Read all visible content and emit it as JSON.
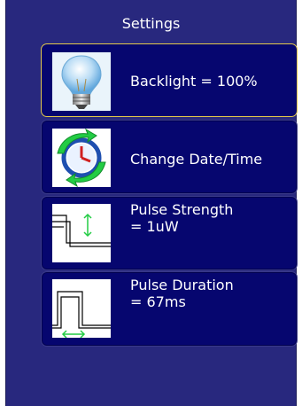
{
  "header": {
    "title": "Settings"
  },
  "items": [
    {
      "label": "Backlight = 100%",
      "icon": "lightbulb-icon"
    },
    {
      "label": "Change Date/Time",
      "icon": "clock-sync-icon"
    },
    {
      "label": "Pulse Strength\n= 1uW",
      "icon": "pulse-strength-icon"
    },
    {
      "label": "Pulse Duration\n= 67ms",
      "icon": "pulse-duration-icon"
    }
  ],
  "colors": {
    "background": "#28287e",
    "item": "#06066f",
    "selected_border": "#e2c84a",
    "icon_green": "#22cc44"
  }
}
